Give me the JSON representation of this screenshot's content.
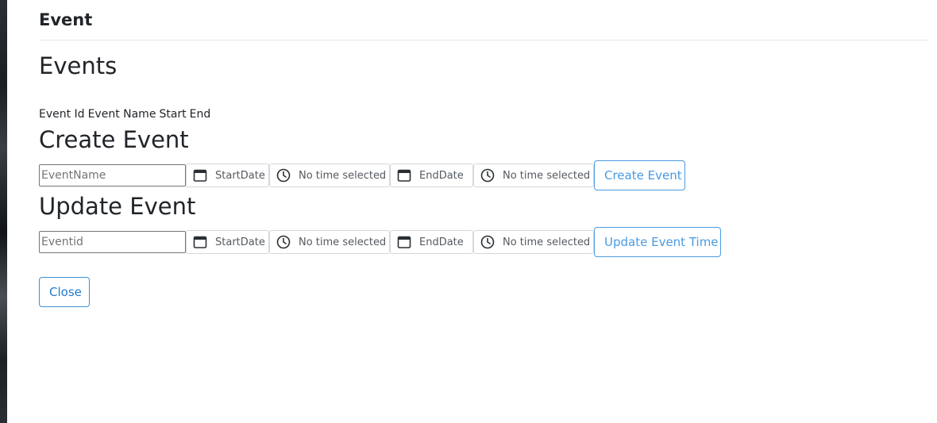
{
  "modal": {
    "title": "Event"
  },
  "events": {
    "heading": "Events",
    "columns": [
      "Event Id",
      "Event Name",
      "Start",
      "End"
    ]
  },
  "create_event": {
    "heading": "Create Event",
    "name_placeholder": "EventName",
    "start_date_label": "StartDate",
    "start_time_label": "No time selected",
    "end_date_label": "EndDate",
    "end_time_label": "No time selected",
    "submit_label": "Create Event"
  },
  "update_event": {
    "heading": "Update Event",
    "id_placeholder": "Eventid",
    "start_date_label": "StartDate",
    "start_time_label": "No time selected",
    "end_date_label": "EndDate",
    "end_time_label": "No time selected",
    "submit_label": "Update Event Time"
  },
  "footer": {
    "close_label": "Close"
  },
  "icons": {
    "date": "calendar-icon",
    "time": "clock-icon"
  },
  "colors": {
    "primary_outline": "#4a9ae0",
    "text": "#212529",
    "border": "#d5d7da"
  }
}
